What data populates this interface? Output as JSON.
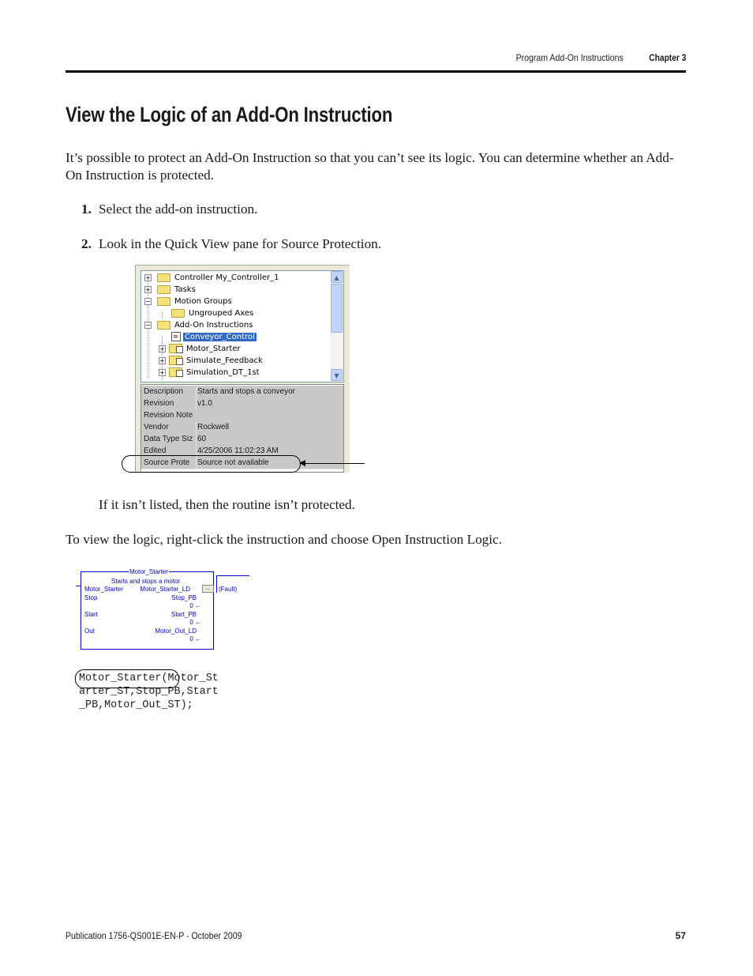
{
  "header": {
    "section": "Program Add-On Instructions",
    "chapter": "Chapter 3"
  },
  "title": "View the Logic of an Add-On Instruction",
  "intro": "It’s possible to protect an Add-On Instruction so that you can’t see its logic. You can determine whether an Add-On Instruction is protected.",
  "steps": [
    {
      "num": "1.",
      "text": "Select the add-on instruction."
    },
    {
      "num": "2.",
      "text": "Look in the Quick View pane for Source Protection."
    }
  ],
  "quick_view": {
    "tree": [
      {
        "label": "Controller My_Controller_1",
        "expander": "+"
      },
      {
        "label": "Tasks",
        "expander": "+"
      },
      {
        "label": "Motion Groups",
        "expander": "−"
      },
      {
        "label": "Ungrouped Axes",
        "expander": ""
      },
      {
        "label": "Add-On Instructions",
        "expander": "−"
      },
      {
        "label": "Conveyor_Control",
        "expander": "",
        "selected": true
      },
      {
        "label": "Motor_Starter",
        "expander": "+"
      },
      {
        "label": "Simulate_Feedback",
        "expander": "+"
      },
      {
        "label": "Simulation_DT_1st",
        "expander": "+"
      }
    ],
    "properties": [
      {
        "key": "Description",
        "value": "Starts and stops a conveyor"
      },
      {
        "key": "Revision",
        "value": "v1.0"
      },
      {
        "key": "Revision Note",
        "value": ""
      },
      {
        "key": "Vendor",
        "value": "Rockwell"
      },
      {
        "key": "Data Type Siz",
        "value": "60"
      },
      {
        "key": "Edited",
        "value": "4/25/2006  11:02:23 AM"
      },
      {
        "key": "Source Prote",
        "value": "Source not available"
      }
    ],
    "scroll_up": "▲",
    "scroll_down": "▼"
  },
  "note": "If it isn’t listed, then the routine isn’t protected.",
  "logic_text": "To view the logic, right-click the instruction and choose Open Instruction Logic.",
  "function_block": {
    "name": "Motor_Starter",
    "description": "Starts and stops a motor",
    "rows": [
      {
        "param": "Motor_Starter",
        "tag": "Motor_Starter_LD",
        "value": ""
      },
      {
        "param": "Stop",
        "tag": "Stop_PB",
        "value": "0"
      },
      {
        "param": "Start",
        "tag": "Start_PB",
        "value": "0"
      },
      {
        "param": "Out",
        "tag": "Motor_Out_LD",
        "value": "0"
      }
    ],
    "browse_button": "...",
    "fault_coil": "(Fault)",
    "value_arrow": "←"
  },
  "code": {
    "lines": [
      "Motor_Starter(Motor_St",
      "arter_ST,Stop_PB,Start",
      "_PB,Motor_Out_ST);"
    ]
  },
  "footer": {
    "publication": "Publication 1756-QS001E-EN-P - October 2009",
    "page": "57"
  }
}
